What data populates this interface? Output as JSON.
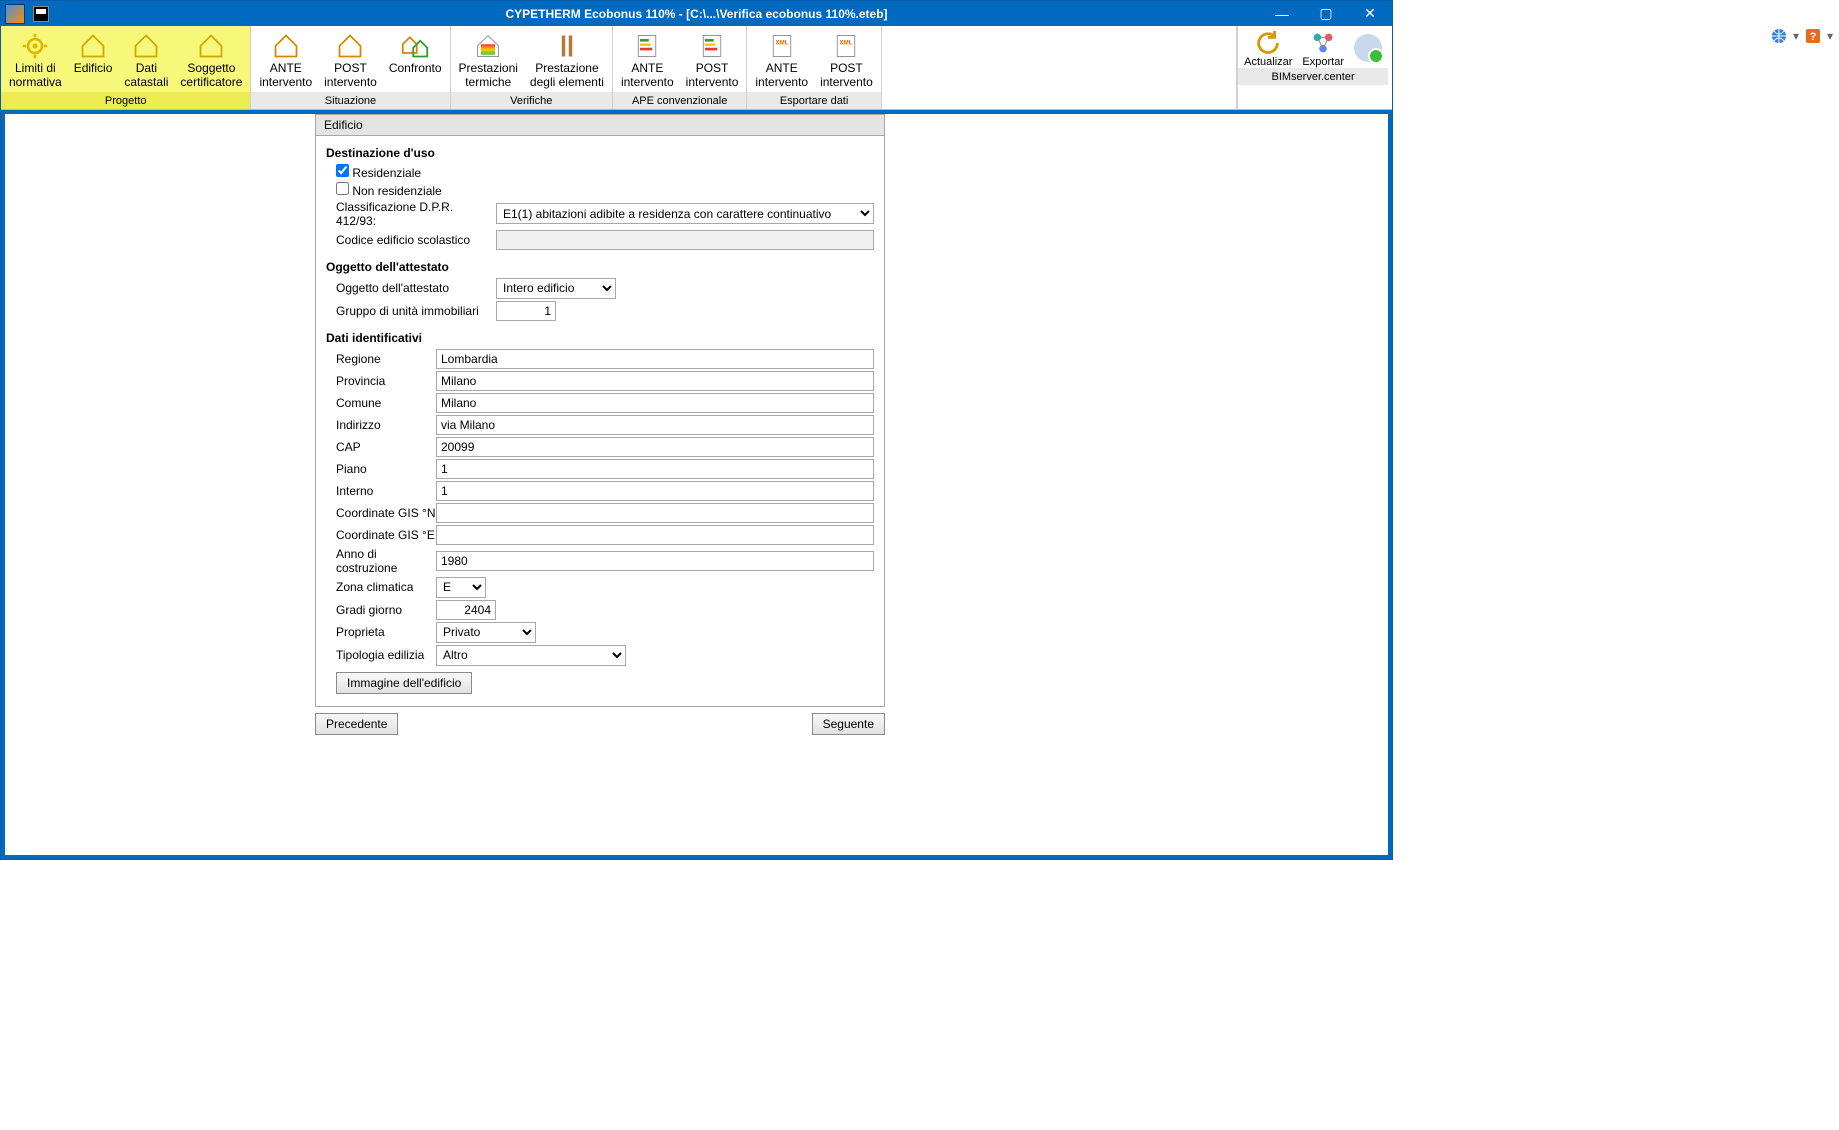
{
  "title": "CYPETHERM Ecobonus 110% - [C:\\...\\Verifica ecobonus 110%.eteb]",
  "ribbon": {
    "groups": {
      "progetto": {
        "label": "Progetto",
        "btn_limiti": "Limiti di\nnormativa",
        "btn_edificio": "Edificio",
        "btn_dati": "Dati\ncatastali",
        "btn_soggetto": "Soggetto\ncertificatore"
      },
      "situazione": {
        "label": "Situazione",
        "btn_ante": "ANTE\nintervento",
        "btn_post": "POST\nintervento",
        "btn_confronto": "Confronto"
      },
      "verifiche": {
        "label": "Verifiche",
        "btn_prestazioni": "Prestazioni\ntermiche",
        "btn_prestazione": "Prestazione\ndegli elementi"
      },
      "ape": {
        "label": "APE convenzionale",
        "btn_ante": "ANTE\nintervento",
        "btn_post": "POST\nintervento"
      },
      "esportare": {
        "label": "Esportare dati",
        "btn_ante": "ANTE\nintervento",
        "btn_post": "POST\nintervento"
      }
    },
    "bim": {
      "label": "BIMserver.center",
      "actualizar": "Actualizar",
      "exportar": "Exportar"
    }
  },
  "panel": {
    "header": "Edificio",
    "dest": {
      "title": "Destinazione d'uso",
      "res": "Residenziale",
      "nonres": "Non residenziale",
      "class_lbl": "Classificazione D.P.R. 412/93:",
      "class_val": "E1(1) abitazioni adibite a residenza con carattere continuativo",
      "codice_lbl": "Codice edificio scolastico",
      "codice_val": ""
    },
    "ogg": {
      "title": "Oggetto dell'attestato",
      "lbl": "Oggetto dell'attestato",
      "val": "Intero edificio",
      "gruppo_lbl": "Gruppo di unità immobiliari",
      "gruppo_val": "1"
    },
    "dati": {
      "title": "Dati identificativi",
      "regione_lbl": "Regione",
      "regione": "Lombardia",
      "provincia_lbl": "Provincia",
      "provincia": "Milano",
      "comune_lbl": "Comune",
      "comune": "Milano",
      "indirizzo_lbl": "Indirizzo",
      "indirizzo": "via Milano",
      "cap_lbl": "CAP",
      "cap": "20099",
      "piano_lbl": "Piano",
      "piano": "1",
      "interno_lbl": "Interno",
      "interno": "1",
      "gisn_lbl": "Coordinate GIS °N",
      "gisn": "",
      "gise_lbl": "Coordinate GIS °E",
      "gise": "",
      "anno_lbl": "Anno di costruzione",
      "anno": "1980",
      "zona_lbl": "Zona climatica",
      "zona": "E",
      "gradi_lbl": "Gradi giorno",
      "gradi": "2404",
      "prop_lbl": "Proprieta",
      "prop": "Privato",
      "tip_lbl": "Tipologia edilizia",
      "tip": "Altro",
      "img_btn": "Immagine dell'edificio"
    }
  },
  "nav": {
    "prev": "Precedente",
    "next": "Seguente"
  }
}
